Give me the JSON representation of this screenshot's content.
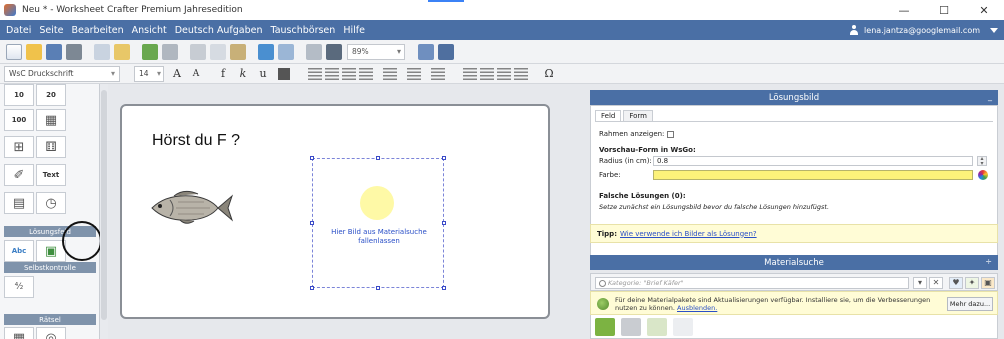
{
  "window": {
    "title": "Neu * - Worksheet Crafter Premium Jahresedition",
    "minimize": "—",
    "maximize": "☐",
    "close": "✕"
  },
  "menu": {
    "items": [
      "Datei",
      "Seite",
      "Bearbeiten",
      "Ansicht",
      "Deutsch Aufgaben",
      "Tauschbörsen",
      "Hilfe"
    ],
    "account_email": "lena.jantza@googlemail.com"
  },
  "toolbar": {
    "zoom": "89%",
    "font": "WsC Druckschrift",
    "font_size": "14",
    "grow_font": "A",
    "shrink_font": "A",
    "bold": "f",
    "italic": "k",
    "underline": "u",
    "omega": "Ω",
    "text_color": "#555555"
  },
  "palette": {
    "tiles": [
      {
        "top": "10",
        "bottom": "20"
      },
      {
        "top": "100",
        "bottom": ""
      },
      {
        "top": "",
        "bottom": ""
      },
      {
        "top": "",
        "bottom": "Text"
      },
      {
        "top": "",
        "bottom": ""
      },
      {
        "top": "Abc",
        "bottom": ""
      }
    ],
    "headers": {
      "loesungsfeld": "Lösungsfeld",
      "selbstkontrolle": "Selbstkontrolle",
      "raetsel": "Rätsel"
    }
  },
  "worksheet": {
    "heading": "Hörst du F ?",
    "drop_text": "Hier Bild aus Materialsuche fallenlassen",
    "fish_icon": "fish-illustration",
    "sun_color": "#fef9a6"
  },
  "loesungsbild": {
    "title": "Lösungsbild",
    "collapse": "_",
    "tabs": [
      "Feld",
      "Form"
    ],
    "rahmen_label": "Rahmen anzeigen:",
    "vorschau_heading": "Vorschau-Form in WsGo:",
    "radius_label": "Radius (in cm):",
    "radius_value": "0.8",
    "farbe_label": "Farbe:",
    "farbe_value": "#fdf27a",
    "falsche_heading": "Falsche Lösungen (0):",
    "falsche_text": "Setze zunächst ein Lösungsbild bevor du falsche Lösungen hinzufügst.",
    "tip_label": "Tipp:",
    "tip_link": "Wie verwende ich Bilder als Lösungen?"
  },
  "materialsuche": {
    "title": "Materialsuche",
    "collapse": "÷",
    "search_placeholder": "Kategorie: \"Brief Käfer\"",
    "notice_text": "Für deine Materialpakete sind Aktualisierungen verfügbar. Installiere sie, um die Verbesserungen nutzen zu können.",
    "notice_link": "Ausblenden.",
    "more_button": "Mehr dazu..."
  },
  "colors": {
    "menubar": "#4a6fa5",
    "accent": "#2a4fc7"
  }
}
